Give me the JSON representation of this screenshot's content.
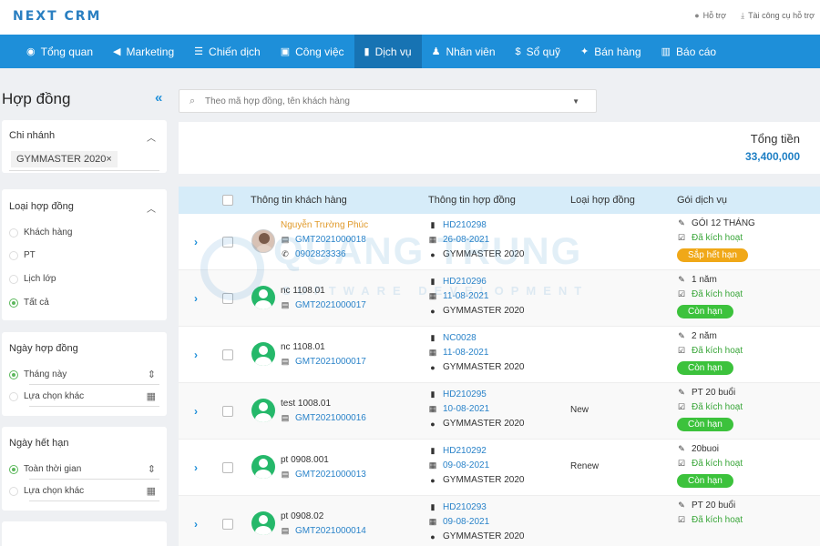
{
  "brand": {
    "logo_text": "NEXT CRM"
  },
  "top_links": [
    {
      "label": "Hỗ trợ",
      "icon": "chat-icon"
    },
    {
      "label": "Tài công cụ hỗ trợ",
      "icon": "download-icon"
    }
  ],
  "nav": [
    {
      "label": "Tổng quan",
      "icon": "eye-icon"
    },
    {
      "label": "Marketing",
      "icon": "megaphone-icon"
    },
    {
      "label": "Chiến dịch",
      "icon": "list-icon"
    },
    {
      "label": "Công việc",
      "icon": "briefcase-icon"
    },
    {
      "label": "Dịch vụ",
      "icon": "service-icon",
      "active": true
    },
    {
      "label": "Nhân viên",
      "icon": "users-icon"
    },
    {
      "label": "Sổ quỹ",
      "icon": "dollar-icon"
    },
    {
      "label": "Bán hàng",
      "icon": "handshake-icon"
    },
    {
      "label": "Báo cáo",
      "icon": "chart-icon"
    }
  ],
  "sidebar": {
    "title": "Hợp đồng",
    "branch": {
      "title": "Chi nhánh",
      "tag": "GYMMASTER 2020",
      "tag_remove": "×"
    },
    "contract_type": {
      "title": "Loại hợp đồng",
      "options": [
        "Khách hàng",
        "PT",
        "Lịch lớp",
        "Tất cả"
      ],
      "selected": "Tất cả"
    },
    "contract_date": {
      "title": "Ngày hợp đồng",
      "options": [
        "Tháng này",
        "Lựa chọn khác"
      ],
      "selected": "Tháng này"
    },
    "expiry_date": {
      "title": "Ngày hết hạn",
      "options": [
        "Toàn thời gian",
        "Lựa chọn khác"
      ],
      "selected": "Toàn thời gian"
    }
  },
  "search": {
    "placeholder": "Theo mã hợp đồng, tên khách hàng"
  },
  "summary": {
    "label": "Tổng tiền",
    "value": "33,400,000"
  },
  "table": {
    "headers": [
      "Thông tin khách hàng",
      "Thông tin hợp đồng",
      "Loại hợp đồng",
      "Gói dịch vụ"
    ],
    "rows": [
      {
        "name": "Nguyễn Trường Phúc",
        "name_style": "orange",
        "code": "GMT2021000018",
        "phone": "0902823336",
        "avatar": "photo",
        "contract_no": "HD210298",
        "date": "26-08-2021",
        "branch": "GYMMASTER 2020",
        "type": "",
        "package": "GÓI 12 THÁNG",
        "status": "Đã kích hoạt",
        "badge": "Sắp hết hạn",
        "badge_color": "orange"
      },
      {
        "name": "nc 1108.01",
        "code": "GMT2021000017",
        "phone": "",
        "avatar": "default",
        "contract_no": "HD210296",
        "date": "11-08-2021",
        "branch": "GYMMASTER 2020",
        "type": "",
        "package": "1 năm",
        "status": "Đã kích hoạt",
        "badge": "Còn hạn",
        "badge_color": "green"
      },
      {
        "name": "nc 1108.01",
        "code": "GMT2021000017",
        "phone": "",
        "avatar": "default",
        "contract_no": "NC0028",
        "date": "11-08-2021",
        "branch": "GYMMASTER 2020",
        "type": "",
        "package": "2 năm",
        "status": "Đã kích hoạt",
        "badge": "Còn hạn",
        "badge_color": "green"
      },
      {
        "name": "test 1008.01",
        "code": "GMT2021000016",
        "phone": "",
        "avatar": "default",
        "contract_no": "HD210295",
        "date": "10-08-2021",
        "branch": "GYMMASTER 2020",
        "type": "New",
        "package": "PT 20 buổi",
        "status": "Đã kích hoạt",
        "badge": "Còn hạn",
        "badge_color": "green"
      },
      {
        "name": "pt 0908.001",
        "code": "GMT2021000013",
        "phone": "",
        "avatar": "default",
        "contract_no": "HD210292",
        "date": "09-08-2021",
        "branch": "GYMMASTER 2020",
        "type": "Renew",
        "package": "20buoi",
        "status": "Đã kích hoạt",
        "badge": "Còn hạn",
        "badge_color": "green"
      },
      {
        "name": "pt 0908.02",
        "code": "GMT2021000014",
        "phone": "",
        "avatar": "default",
        "contract_no": "HD210293",
        "date": "09-08-2021",
        "branch": "GYMMASTER 2020",
        "type": "",
        "package": "PT 20 buổi",
        "status": "Đã kích hoạt",
        "badge": "",
        "badge_color": "green"
      }
    ]
  },
  "watermark": {
    "title": "QUANG TRUNG",
    "subtitle": "SOFTWARE DEVELOPMENT"
  }
}
